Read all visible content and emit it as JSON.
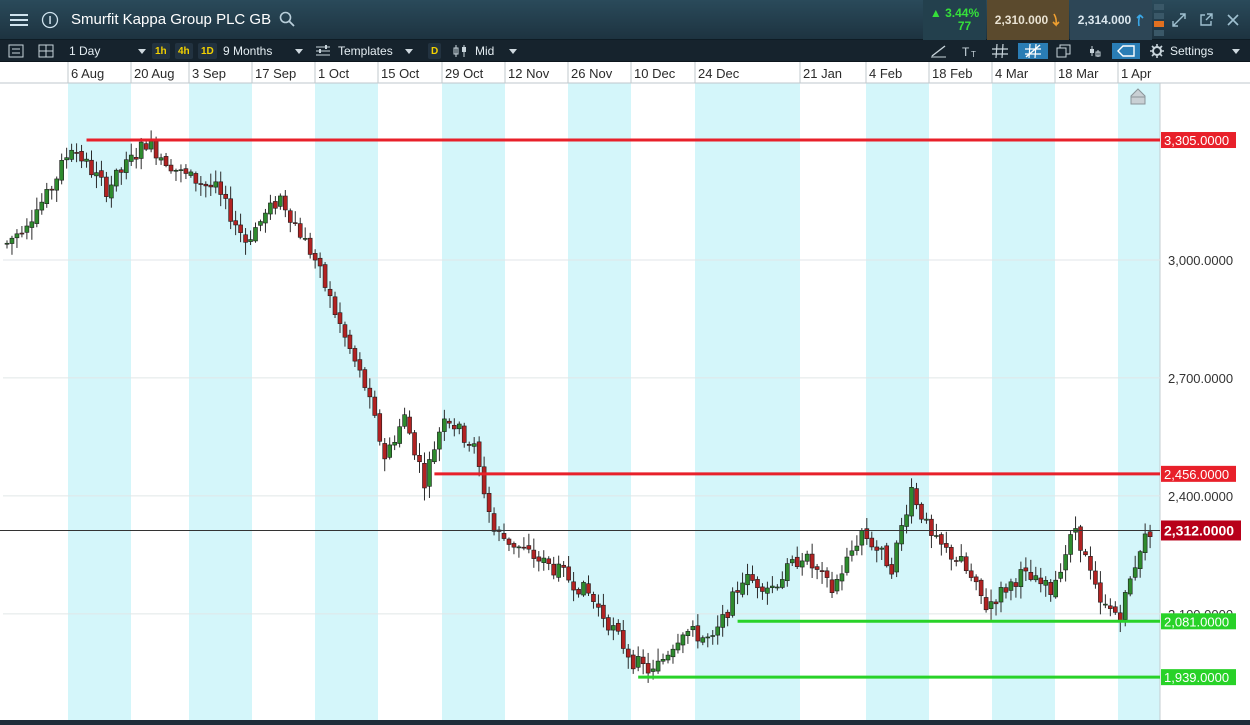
{
  "header": {
    "title": "Smurfit Kappa Group PLC GB",
    "change_pct": "▲ 3.44%",
    "change_count": "77",
    "sell_price": "2,310.000",
    "buy_price": "2,314.000"
  },
  "toolbar": {
    "interval": "1 Day",
    "quick_1h": "1h",
    "quick_4h": "4h",
    "quick_1d": "1D",
    "range": "9 Months",
    "templates": "Templates",
    "d_chip": "D",
    "price_type": "Mid",
    "settings": "Settings"
  },
  "colors": {
    "up": "#2e8b2e",
    "down": "#b22222",
    "resistance": "#e8202a",
    "support": "#28d228",
    "band": "#d4f6fa",
    "current": "#b8001a"
  },
  "chart_data": {
    "type": "candlestick",
    "x_tick_labels": [
      "6 Aug",
      "20 Aug",
      "3 Sep",
      "17 Sep",
      "1 Oct",
      "15 Oct",
      "29 Oct",
      "12 Nov",
      "26 Nov",
      "10 Dec",
      "24 Dec",
      "21 Jan",
      "4 Feb",
      "18 Feb",
      "4 Mar",
      "18 Mar",
      "1 Apr"
    ],
    "y_tick_labels": [
      "3,000.0000",
      "2,700.0000",
      "2,400.0000",
      "2,100.0000"
    ],
    "y_ticks": [
      3000,
      2700,
      2400,
      2100
    ],
    "ylim": [
      1830,
      3450
    ],
    "horizontal_lines": [
      {
        "label": "3,305.0000",
        "value": 3305,
        "kind": "resistance"
      },
      {
        "label": "2,456.0000",
        "value": 2456,
        "kind": "resistance"
      },
      {
        "label": "2,081.0000",
        "value": 2081,
        "kind": "support"
      },
      {
        "label": "1,939.0000",
        "value": 1939,
        "kind": "support"
      }
    ],
    "current_price": {
      "label": "2,312.0000",
      "value": 2312
    },
    "anchor_points": [
      [
        0,
        3040
      ],
      [
        8,
        3160
      ],
      [
        13,
        3290
      ],
      [
        20,
        3180
      ],
      [
        28,
        3300
      ],
      [
        35,
        3220
      ],
      [
        42,
        3180
      ],
      [
        48,
        3050
      ],
      [
        55,
        3160
      ],
      [
        62,
        3000
      ],
      [
        68,
        2800
      ],
      [
        72,
        2680
      ],
      [
        76,
        2500
      ],
      [
        80,
        2600
      ],
      [
        84,
        2440
      ],
      [
        88,
        2610
      ],
      [
        94,
        2520
      ],
      [
        98,
        2310
      ],
      [
        104,
        2260
      ],
      [
        112,
        2200
      ],
      [
        117,
        2150
      ],
      [
        122,
        2060
      ],
      [
        126,
        1980
      ],
      [
        130,
        1950
      ],
      [
        136,
        2060
      ],
      [
        142,
        2030
      ],
      [
        148,
        2190
      ],
      [
        154,
        2170
      ],
      [
        160,
        2250
      ],
      [
        166,
        2160
      ],
      [
        172,
        2310
      ],
      [
        178,
        2220
      ],
      [
        182,
        2420
      ],
      [
        186,
        2290
      ],
      [
        192,
        2230
      ],
      [
        197,
        2120
      ],
      [
        204,
        2200
      ],
      [
        210,
        2160
      ],
      [
        215,
        2320
      ],
      [
        220,
        2120
      ],
      [
        224,
        2100
      ],
      [
        228,
        2270
      ],
      [
        230,
        2312
      ]
    ]
  }
}
